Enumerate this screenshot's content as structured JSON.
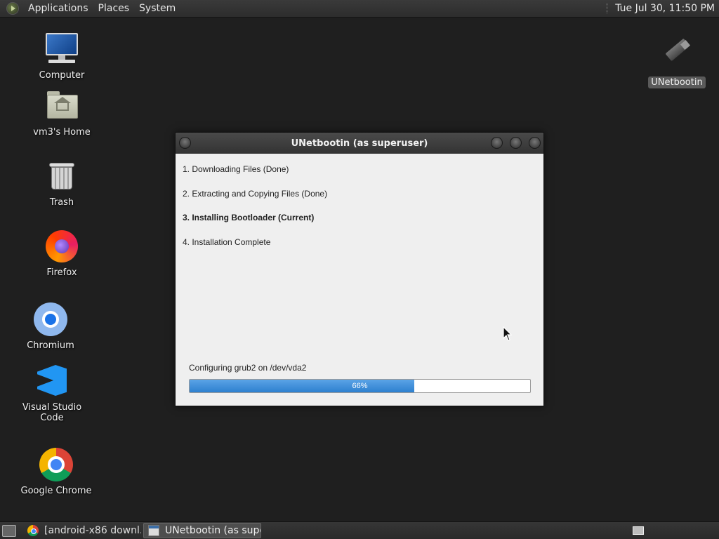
{
  "top_panel": {
    "menus": [
      "Applications",
      "Places",
      "System"
    ],
    "clock": "Tue Jul 30, 11:50 PM"
  },
  "desktop": {
    "icons": [
      {
        "label": "Computer",
        "icon": "computer-icon"
      },
      {
        "label": "vm3's Home",
        "icon": "home-folder-icon"
      },
      {
        "label": "Trash",
        "icon": "trash-icon"
      },
      {
        "label": "Firefox",
        "icon": "firefox-icon"
      },
      {
        "label": "Chromium",
        "icon": "chromium-icon"
      },
      {
        "label": "Visual Studio Code",
        "icon": "vscode-icon"
      },
      {
        "label": "Google Chrome",
        "icon": "chrome-icon"
      },
      {
        "label": "UNetbootin",
        "icon": "unetbootin-icon"
      }
    ]
  },
  "dialog": {
    "title": "UNetbootin (as superuser)",
    "steps": [
      {
        "text": "1. Downloading Files (Done)",
        "current": false
      },
      {
        "text": "2. Extracting and Copying Files (Done)",
        "current": false
      },
      {
        "text": "3. Installing Bootloader (Current)",
        "current": true
      },
      {
        "text": "4. Installation Complete",
        "current": false
      }
    ],
    "status": "Configuring grub2 on /dev/vda2",
    "progress_label": "66%",
    "progress_fraction": 0.66
  },
  "taskbar": {
    "tasks": [
      {
        "label": "[android-x86 downl...",
        "icon": "chrome-icon",
        "active": false
      },
      {
        "label": "UNetbootin (as supe...",
        "icon": "window-icon",
        "active": true
      }
    ]
  },
  "colors": {
    "desktop_bg": "#1f1f1f",
    "progress_fill": "#3a8ad6",
    "window_bg": "#efefef"
  }
}
